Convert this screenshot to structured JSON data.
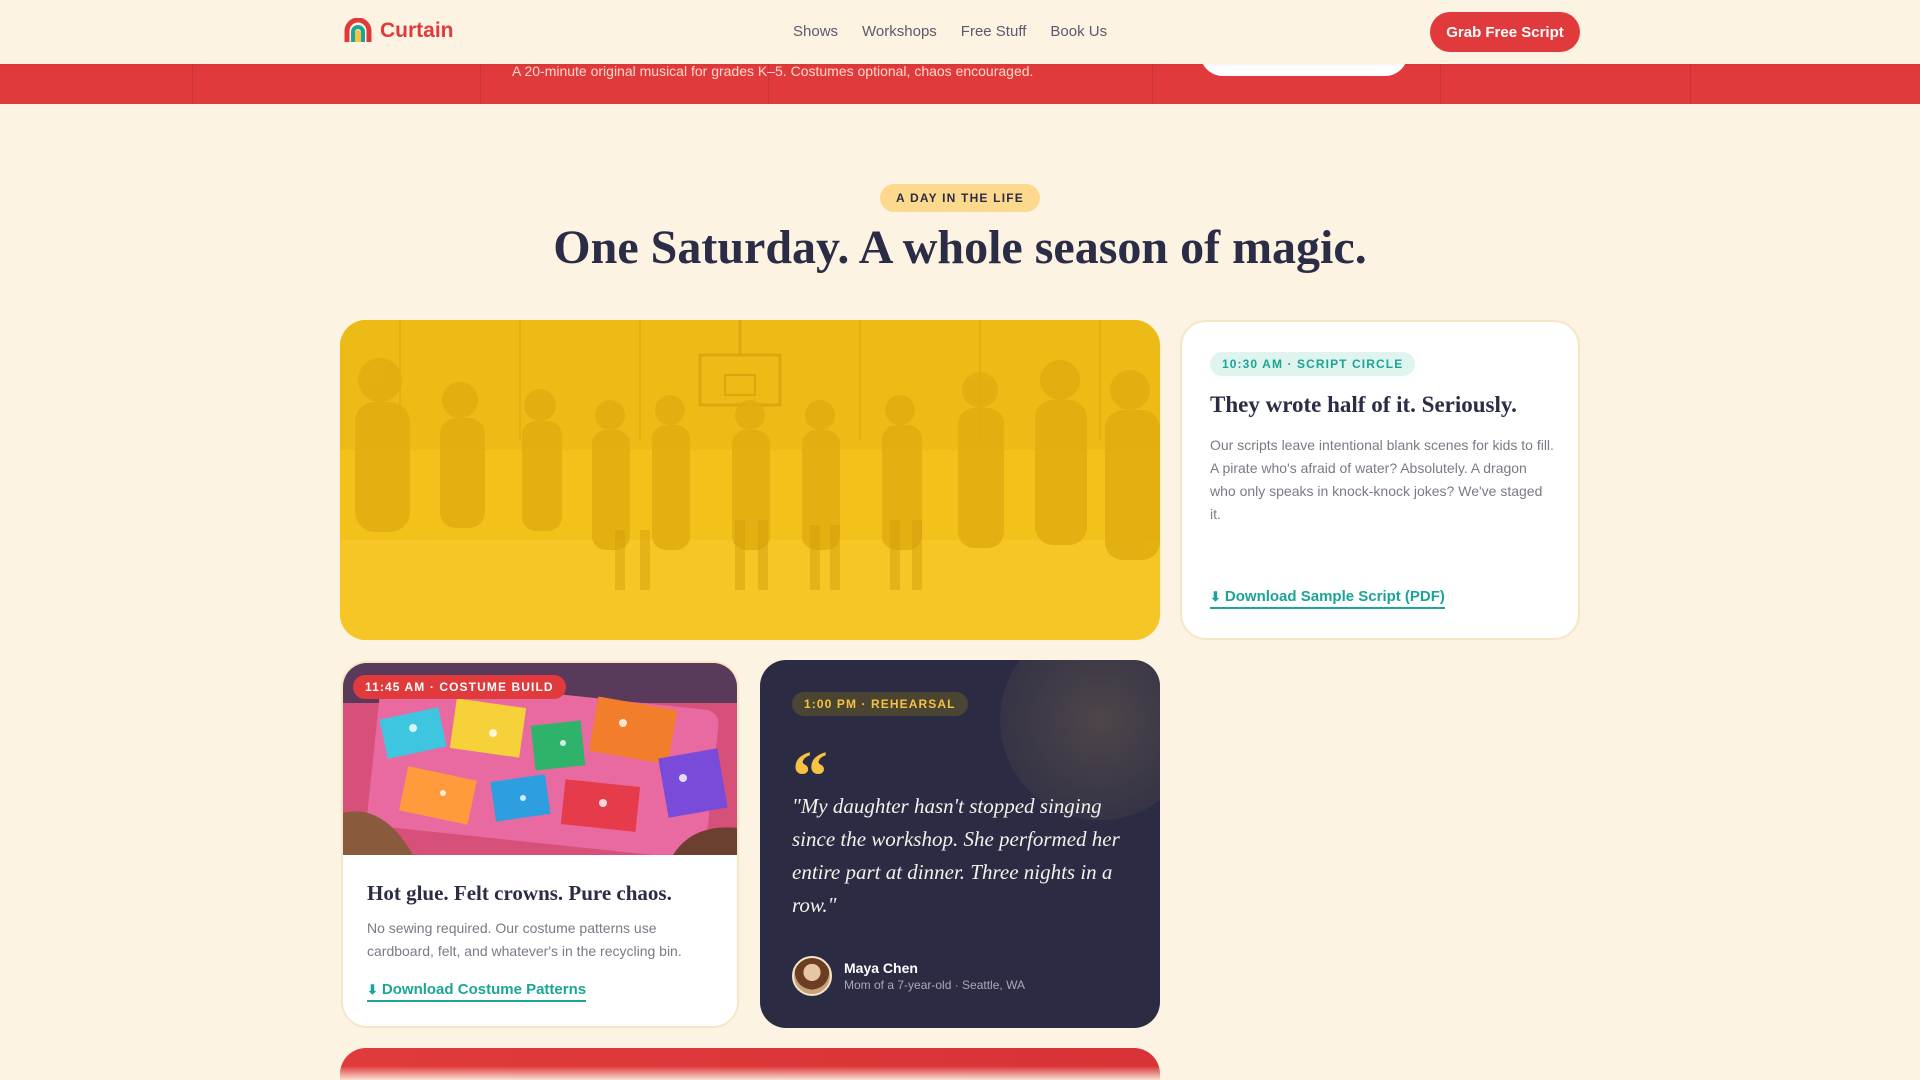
{
  "colors": {
    "brand_red": "#e03a3c",
    "teal": "#1aa596",
    "cream": "#fdf3e3",
    "navy": "#2b2c44",
    "yellow": "#f5c243"
  },
  "hero": {
    "subtitle": "A 20-minute original musical for grades K–5. Costumes optional, chaos encouraged."
  },
  "header": {
    "brand": "Curtain",
    "logo_icon": "rainbow-curtain-icon",
    "nav": [
      "Shows",
      "Workshops",
      "Free Stuff",
      "Book Us"
    ],
    "cta": "Grab Free Script"
  },
  "section": {
    "eyebrow": "A DAY IN THE LIFE",
    "title": "One Saturday. A whole season of magic."
  },
  "cards": {
    "script": {
      "tag": "10:30 AM · SCRIPT CIRCLE",
      "title": "They wrote half of it. Seriously.",
      "body": "Our scripts leave intentional blank scenes for kids to fill. A pirate who's afraid of water? Absolutely. A dragon who only speaks in knock-knock jokes? We've staged it.",
      "link_icon": "download-icon",
      "link": "Download Sample Script (PDF)"
    },
    "costume": {
      "tag": "11:45 AM · COSTUME BUILD",
      "title": "Hot glue. Felt crowns. Pure chaos.",
      "body": "No sewing required. Our costume patterns use cardboard, felt, and whatever's in the recycling bin.",
      "link_icon": "download-icon",
      "link": "Download Costume Patterns"
    },
    "rehearsal": {
      "tag": "1:00 PM · REHEARSAL",
      "quote_mark": "“",
      "quote": "\"My daughter hasn't stopped singing since the workshop. She performed her entire part at dinner. Three nights in a row.\"",
      "author": "Maya Chen",
      "author_meta": "Mom of a 7-year-old · Seattle, WA"
    }
  }
}
